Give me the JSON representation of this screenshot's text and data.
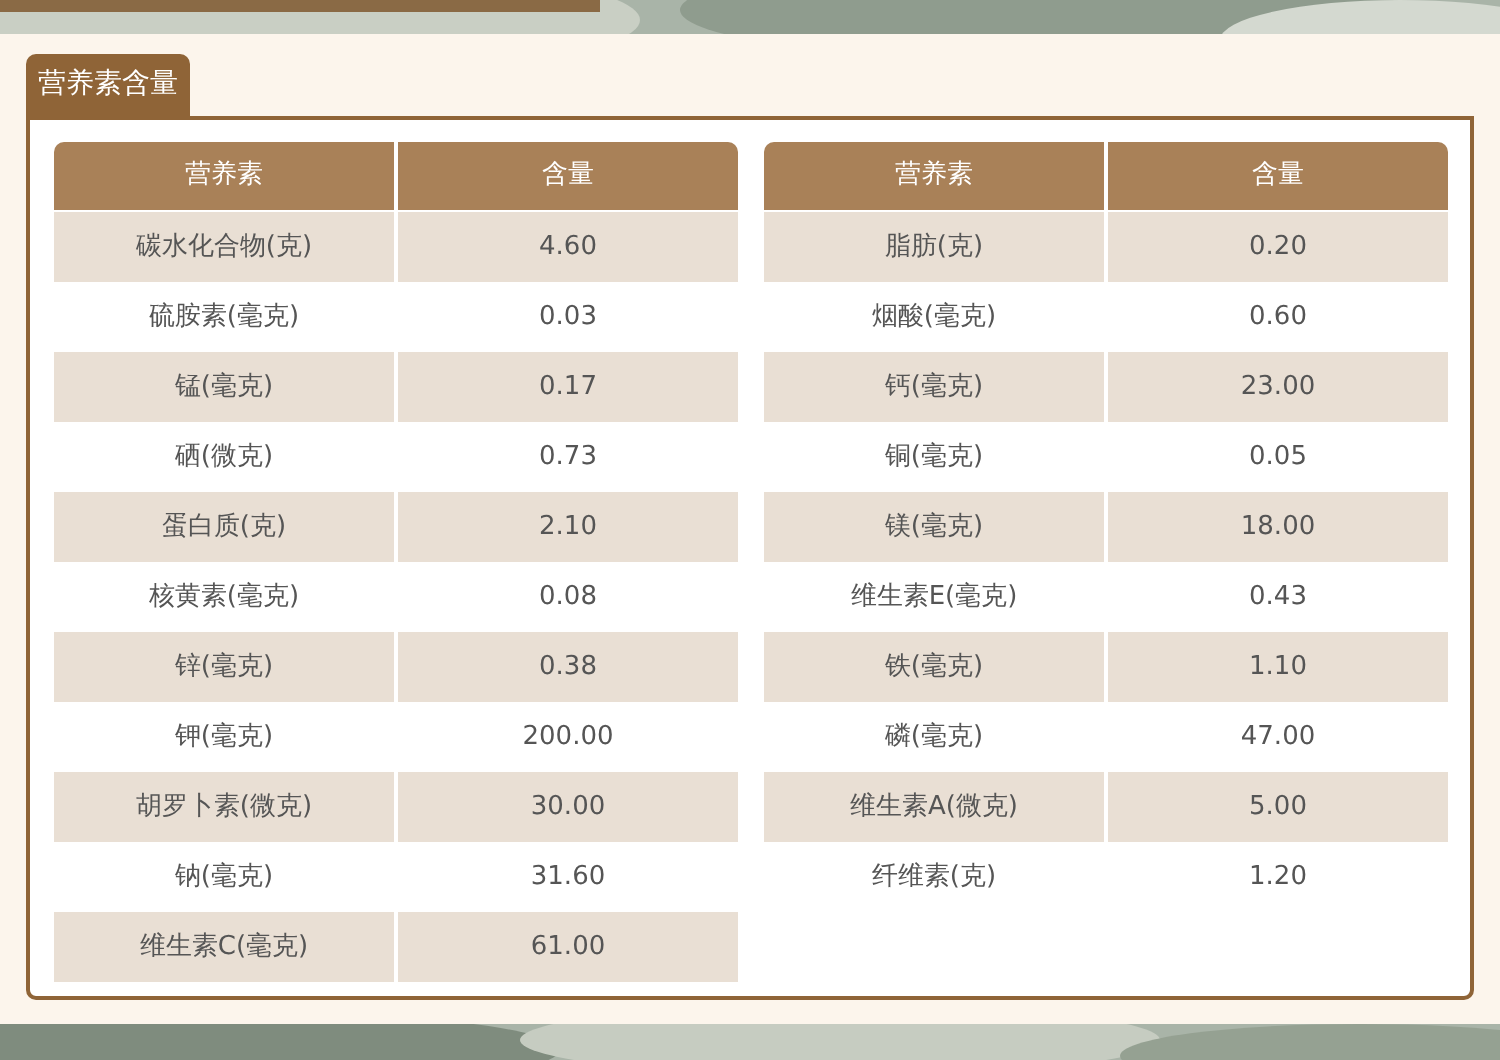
{
  "tab": {
    "label": "营养素含量",
    "selected": true
  },
  "tables": [
    {
      "columns": [
        "营养素",
        "含量"
      ],
      "rows": [
        [
          "碳水化合物(克)",
          "4.60"
        ],
        [
          "硫胺素(毫克)",
          "0.03"
        ],
        [
          "锰(毫克)",
          "0.17"
        ],
        [
          "硒(微克)",
          "0.73"
        ],
        [
          "蛋白质(克)",
          "2.10"
        ],
        [
          "核黄素(毫克)",
          "0.08"
        ],
        [
          "锌(毫克)",
          "0.38"
        ],
        [
          "钾(毫克)",
          "200.00"
        ],
        [
          "胡罗卜素(微克)",
          "30.00"
        ],
        [
          "钠(毫克)",
          "31.60"
        ],
        [
          "维生素C(毫克)",
          "61.00"
        ]
      ]
    },
    {
      "columns": [
        "营养素",
        "含量"
      ],
      "rows": [
        [
          "脂肪(克)",
          "0.20"
        ],
        [
          "烟酸(毫克)",
          "0.60"
        ],
        [
          "钙(毫克)",
          "23.00"
        ],
        [
          "铜(毫克)",
          "0.05"
        ],
        [
          "镁(毫克)",
          "18.00"
        ],
        [
          "维生素E(毫克)",
          "0.43"
        ],
        [
          "铁(毫克)",
          "1.10"
        ],
        [
          "磷(毫克)",
          "47.00"
        ],
        [
          "维生素A(微克)",
          "5.00"
        ],
        [
          "纤维素(克)",
          "1.20"
        ]
      ]
    }
  ]
}
